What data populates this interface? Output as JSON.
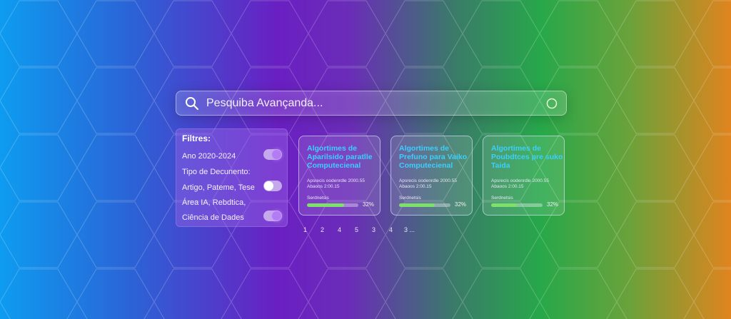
{
  "search": {
    "placeholder": "Pesquiba Avançanda..."
  },
  "filters": {
    "title": "Filtres:",
    "rows": [
      {
        "label": "Ano  2020-2024",
        "toggle": "on"
      },
      {
        "label": "Tipo de Decunento:",
        "toggle": null
      },
      {
        "label": "Artigo, Pateme, Tese",
        "toggle": "off"
      },
      {
        "label": "Área IA, Rebdtica,",
        "toggle": null
      },
      {
        "label": "Ciência de Dades",
        "toggle": "on"
      }
    ]
  },
  "cards": [
    {
      "title": "Algortimes de Aparilsido paratlle Computecienal",
      "meta1": "Apsrecis oodenrdle 2000.55",
      "meta2": "Abaoos 2:00.15",
      "label": "Serdnetsis",
      "percent": "32%",
      "progress": 0.72
    },
    {
      "title": "Algortimes de Prefuno para Vaiko Computecienal",
      "meta1": "Apsrecis oodenrdle 2000.55",
      "meta2": "Abaoos 2:00.15",
      "label": "Serdnetsis",
      "percent": "32%",
      "progress": 0.7
    },
    {
      "title": "Algortimes de Poubdtces pre suko Taida",
      "meta1": "Apsrecis oodenrdle 2000.55",
      "meta2": "Abaoos 2:00.15",
      "label": "Serdnetsis",
      "percent": "32%",
      "progress": 0.5
    }
  ],
  "pagination": [
    "1",
    "2",
    "4",
    "5",
    "3",
    "4",
    "3 ..."
  ],
  "colors": {
    "accent": "#b37cf5",
    "card_title": "#3ad0ff",
    "progress": "#7de06a"
  },
  "icons": {
    "search": "search-icon",
    "voice": "circle-icon"
  }
}
